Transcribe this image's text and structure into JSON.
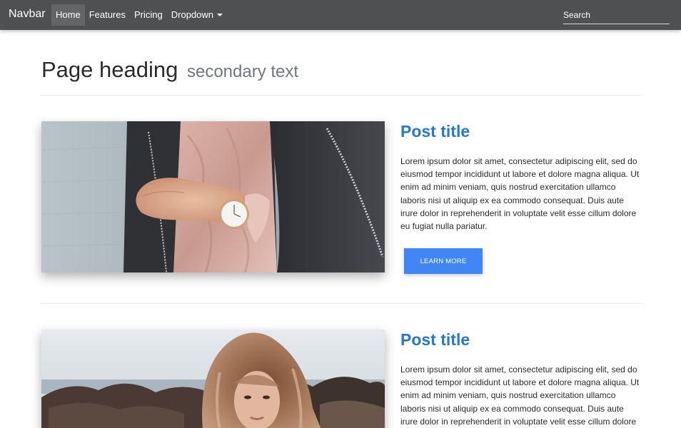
{
  "navbar": {
    "brand": "Navbar",
    "items": [
      {
        "label": "Home",
        "active": true
      },
      {
        "label": "Features",
        "active": false
      },
      {
        "label": "Pricing",
        "active": false
      },
      {
        "label": "Dropdown",
        "active": false,
        "has_dropdown": true
      }
    ],
    "search": {
      "placeholder": "Search",
      "value": ""
    }
  },
  "page": {
    "heading": "Page heading",
    "secondary": "secondary text"
  },
  "posts": [
    {
      "title": "Post title",
      "body": "Lorem ipsum dolor sit amet, consectetur adipiscing elit, sed do eiusmod tempor incididunt ut labore et dolore magna aliqua. Ut enim ad minim veniam, quis nostrud exercitation ullamco laboris nisi ut aliquip ex ea commodo consequat. Duis aute irure dolor in reprehenderit in voluptate velit esse cillum dolore eu fugiat nulla pariatur.",
      "button": "LEARN MORE",
      "image": "woman-wristwatch-photo"
    },
    {
      "title": "Post title",
      "body": "Lorem ipsum dolor sit amet, consectetur adipiscing elit, sed do eiusmod tempor incididunt ut labore et dolore magna aliqua. Ut enim ad minim veniam, quis nostrud exercitation ullamco laboris nisi ut aliquip ex ea commodo consequat. Duis aute irure dolor in reprehenderit in voluptate velit esse cillum dolore eu fugiat nulla pariatur.",
      "image": "woman-portrait-beach-photo"
    }
  ],
  "colors": {
    "navbar_bg": "#4f5052",
    "nav_active_bg": "#646567",
    "title": "#2578d0",
    "button": "#4285f4"
  }
}
